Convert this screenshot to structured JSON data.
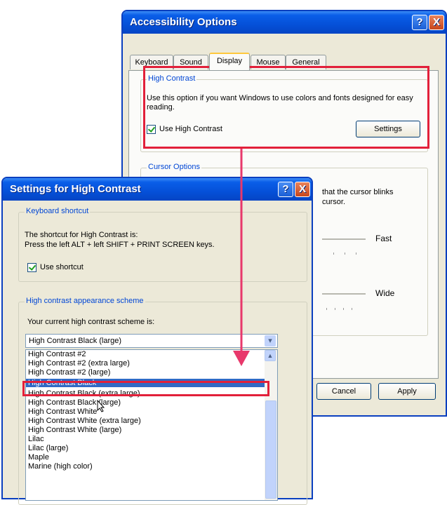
{
  "accessibility": {
    "title": "Accessibility Options",
    "help_glyph": "?",
    "close_glyph": "X",
    "tabs": [
      {
        "label": "Keyboard"
      },
      {
        "label": "Sound"
      },
      {
        "label": "Display"
      },
      {
        "label": "Mouse"
      },
      {
        "label": "General"
      }
    ],
    "active_tab": "Display",
    "high_contrast": {
      "group_title": "High Contrast",
      "description": "Use this option if you want Windows to use colors and fonts designed for easy reading.",
      "checkbox_label": "Use High Contrast",
      "checked": true,
      "settings_button": "Settings"
    },
    "cursor_options": {
      "group_title": "Cursor Options",
      "blink_text_1": "that the cursor blinks",
      "blink_text_2": "cursor.",
      "blink_fast_label": "Fast",
      "width_wide_label": "Wide"
    },
    "cancel_button": "Cancel",
    "apply_button": "Apply"
  },
  "settings": {
    "title": "Settings for High Contrast",
    "help_glyph": "?",
    "close_glyph": "X",
    "keyboard_shortcut": {
      "group_title": "Keyboard shortcut",
      "line1": "The shortcut for High Contrast is:",
      "line2": "Press the left ALT + left SHIFT + PRINT SCREEN keys.",
      "checkbox_label": "Use shortcut",
      "checked": true
    },
    "scheme": {
      "group_title": "High contrast appearance scheme",
      "label": "Your current high contrast scheme is:",
      "selected_value": "High Contrast Black (large)",
      "dropdown_arrow": "▾",
      "options": [
        "High Contrast #2",
        "High Contrast #2 (extra large)",
        "High Contrast #2 (large)",
        "High Contrast Black",
        "High Contrast Black (extra large)",
        "High Contrast Black (large)",
        "High Contrast White",
        "High Contrast White (extra large)",
        "High Contrast White (large)",
        "Lilac",
        "Lilac (large)",
        "Maple",
        "Marine (high color)"
      ],
      "highlighted_option": "High Contrast Black"
    }
  },
  "colors": {
    "title_bar_blue": "#0a5ee8",
    "highlight_box": "#e2203a",
    "arrow": "#e8386b",
    "selection": "#316ac5",
    "group_title_blue": "#0046d5"
  }
}
